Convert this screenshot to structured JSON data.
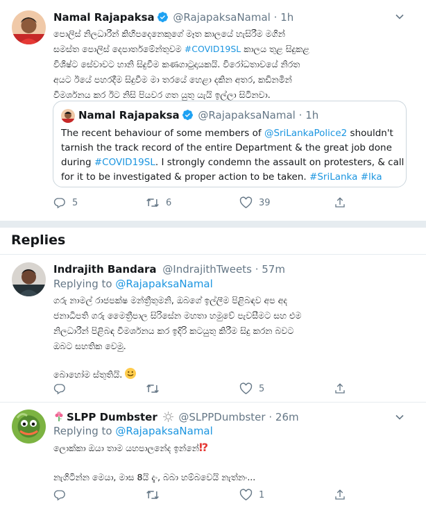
{
  "main_tweet": {
    "name": "Namal Rajapaksa",
    "handle": "@RajapaksaNamal",
    "dot": "·",
    "time": "1h",
    "lines": [
      "පොලිස් නිලධාරීන් කිහිපදෙනෙකුගේ මෑත කාලයේ හැසිරීම මගින්",
      "සමස්ත පොලිස් දෙපාර්තමේන්තුවම",
      "කාලය තුළ සිදුකළ",
      "විශිෂ්ට සේවාවට හානි සිදුවීම කණගාටුදායකයි. විරෝධතාවයේ නිරත",
      "අයට ඊයේ පහරදීම සිදුවීම මා තරයේ හෙළා දකින අතර, කඩිනමින්",
      "විමර්ශනය කර ඊට නිසි පියවර ගත යුතු යැයි ඉල්ලා සිටිනවා."
    ],
    "hashtag": "#COVID19SL",
    "actions": {
      "replies": "5",
      "retweets": "6",
      "likes": "39"
    }
  },
  "quoted_tweet": {
    "name": "Namal Rajapaksa",
    "handle": "@RajapaksaNamal",
    "dot": "·",
    "time": "1h",
    "line1_pre": "The recent behaviour of some members of ",
    "line1_link": "@SriLankaPolice2",
    "line1_post": " shouldn't",
    "line2": "tarnish the track record of the entire Department & the great job done",
    "line3_pre": "during ",
    "line3_link": "#COVID19SL",
    "line3_post": ". I strongly condemn the assault on protesters, & call",
    "line4_pre": "for it to be investigated & proper action to be taken. ",
    "line4_link1": "#SriLanka",
    "line4_link2": "#lka"
  },
  "replies_heading": "Replies",
  "reply1": {
    "name": "Indrajith Bandara",
    "handle": "@IndrajithTweets",
    "dot": "·",
    "time": "57m",
    "replying_label": "Replying to",
    "replying_to": "@RajapaksaNamal",
    "lines": [
      "ගරු නාමල් රාජපක්ෂ මන්ත්‍රීතුමනි, ඔබගේ ඉල්ලීම පිළිබඳව අප අද",
      "ජනාධිපති ගරු මෛත්‍රීපාල සිරිසේන මහතා හමුවේ පැවසීමට සහ එම",
      "නිලධාරීන් පිළිබඳ විමර්ශනය කර ඉදිරි කටයුතු කිරීම සිදු කරන බවට",
      "ඔබට සහතික වෙමු."
    ],
    "thanks": "බොහෝම ස්තුතියි.",
    "actions": {
      "replies": "",
      "retweets": "",
      "likes": "5"
    }
  },
  "reply2": {
    "name": "SLPP Dumbster",
    "handle": "@SLPPDumbster",
    "dot": "·",
    "time": "26m",
    "replying_label": "Replying to",
    "replying_to": "@RajapaksaNamal",
    "line1": "ලොක්කා ඔයා තාම යහපාලනේද ඉන්නේ",
    "line1_mark": "⁉",
    "line2": "නැගිටින්න මෙයා, මාස 8යි දැං, බබා හම්බවෙයි නැත්නං...",
    "actions": {
      "replies": "",
      "retweets": "",
      "likes": "1"
    }
  },
  "colors": {
    "accent": "#1b95e0",
    "verified": "#1da1f2",
    "muted": "#657786",
    "border": "#e6ecf0"
  },
  "icons": [
    "verified-icon",
    "caret-down-icon",
    "reply-icon",
    "retweet-icon",
    "like-icon",
    "share-icon",
    "flower-emoji",
    "sun-emoji",
    "smile-emoji",
    "interrobang-emoji"
  ]
}
